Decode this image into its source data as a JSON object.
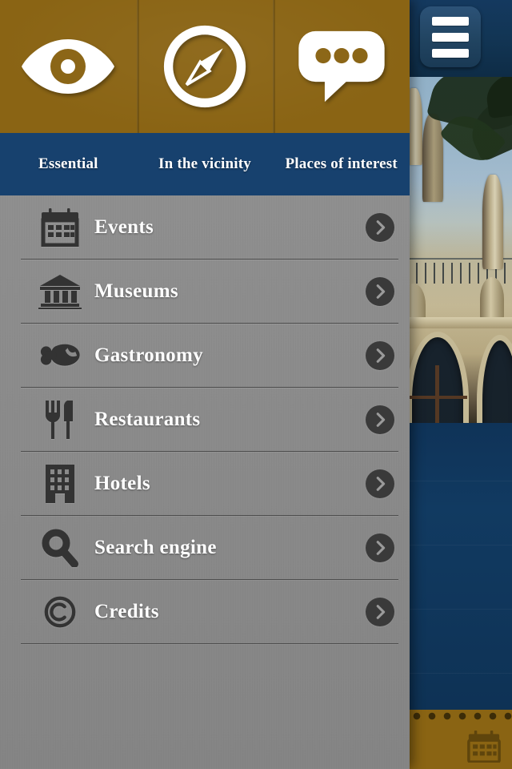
{
  "app": {
    "hamburger_label": "Open menu",
    "icon_names": [
      "eye-icon",
      "compass-icon",
      "chat-bubble-icon",
      "hamburger-icon"
    ]
  },
  "colors": {
    "gold": "#8a6414",
    "navy": "#17416e",
    "panel_gray": "#8a8a8a",
    "separator": "#4e4e4e",
    "arrow_circle": "#3a3a3a",
    "label_text": "#ffffff",
    "icon_dark": "#333333",
    "footer_gold": "#8a6413",
    "background_blue": "#0f3358"
  },
  "tabs": [
    {
      "label": "Essential",
      "icon": "eye-icon",
      "selected": true
    },
    {
      "label": "In the vicinity",
      "icon": "compass-icon",
      "selected": false
    },
    {
      "label": "Places of interest",
      "icon": "chat-bubble-icon",
      "selected": false
    }
  ],
  "menu": {
    "items": [
      {
        "label": "Events",
        "icon": "calendar-icon",
        "arrow": "chevron-right-icon"
      },
      {
        "label": "Museums",
        "icon": "museum-icon",
        "arrow": "chevron-right-icon"
      },
      {
        "label": "Gastronomy",
        "icon": "drumstick-icon",
        "arrow": "chevron-right-icon"
      },
      {
        "label": "Restaurants",
        "icon": "cutlery-icon",
        "arrow": "chevron-right-icon"
      },
      {
        "label": "Hotels",
        "icon": "building-icon",
        "arrow": "chevron-right-icon"
      },
      {
        "label": "Search engine",
        "icon": "magnifier-icon",
        "arrow": "chevron-right-icon"
      },
      {
        "label": "Credits",
        "icon": "copyright-icon",
        "arrow": "chevron-right-icon"
      }
    ]
  },
  "background": {
    "photo_alt": "Gothic modernist building facade with arched windows under blue sky",
    "footer_icon": "calendar-icon"
  }
}
